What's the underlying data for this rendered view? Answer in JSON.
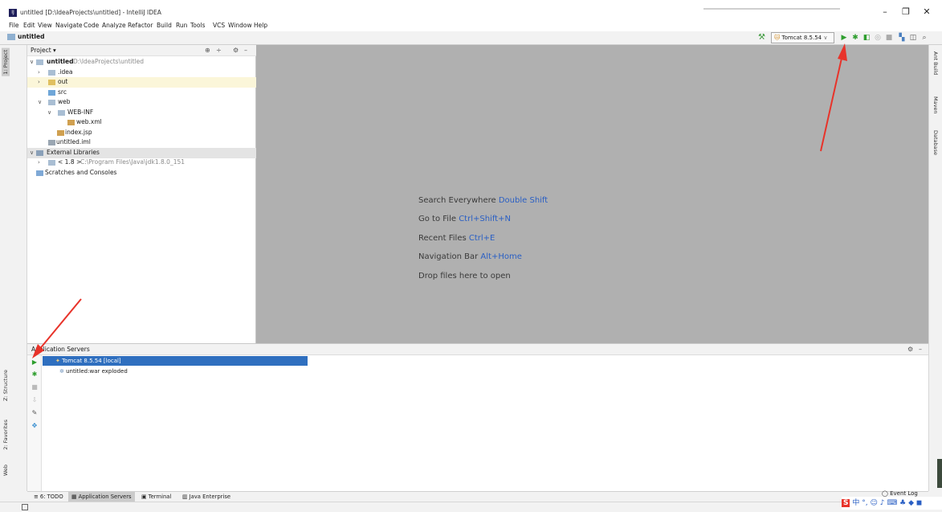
{
  "window": {
    "title": "untitled [D:\\IdeaProjects\\untitled] - IntelliJ IDEA",
    "minimize": "–",
    "restore": "❐",
    "close": "✕"
  },
  "menu": [
    "File",
    "Edit",
    "View",
    "Navigate",
    "Code",
    "Analyze",
    "Refactor",
    "Build",
    "Run",
    "Tools",
    "VCS",
    "Window",
    "Help"
  ],
  "navbar": {
    "breadcrumb": "untitled",
    "run_config": "Tomcat 8.5.54",
    "run_config_caret": "∨"
  },
  "left_stripe": {
    "project_tab": "1: Project",
    "structure_tab": "Z: Structure",
    "favorites_tab": "2: Favorites",
    "web_tab": "Web"
  },
  "right_stripe": {
    "ant_tab": "Ant Build",
    "maven_tab": "Maven",
    "database_tab": "Database"
  },
  "project_panel": {
    "header": "Project ▾",
    "tree": [
      {
        "label": "untitled",
        "extra": "D:\\IdeaProjects\\untitled"
      },
      {
        "label": ".idea"
      },
      {
        "label": "out"
      },
      {
        "label": "src"
      },
      {
        "label": "web"
      },
      {
        "label": "WEB-INF"
      },
      {
        "label": "web.xml"
      },
      {
        "label": "index.jsp"
      },
      {
        "label": "untitled.iml"
      },
      {
        "label": "External Libraries"
      },
      {
        "label": "< 1.8 >",
        "extra": "C:\\Program Files\\Java\\jdk1.8.0_151"
      },
      {
        "label": "Scratches and Consoles"
      }
    ]
  },
  "editor_hints": [
    {
      "text": "Search Everywhere",
      "shortcut": "Double Shift"
    },
    {
      "text": "Go to File",
      "shortcut": "Ctrl+Shift+N"
    },
    {
      "text": "Recent Files",
      "shortcut": "Ctrl+E"
    },
    {
      "text": "Navigation Bar",
      "shortcut": "Alt+Home"
    },
    {
      "text": "Drop files here to open",
      "shortcut": ""
    }
  ],
  "servers_panel": {
    "title": "Application Servers",
    "server": "Tomcat 8.5.54 [local]",
    "artifact": "untitled:war exploded"
  },
  "bottom_tabs": [
    {
      "label": "6: TODO",
      "icon": "≡"
    },
    {
      "label": "Application Servers",
      "icon": "▦"
    },
    {
      "label": "Terminal",
      "icon": "▣"
    },
    {
      "label": "Java Enterprise",
      "icon": "▥"
    }
  ],
  "status": {
    "event_log": "Event Log",
    "ime_text": "中"
  },
  "colors": {
    "selection": "#2f6fbf",
    "run_green": "#2e9e2e",
    "editor_bg": "#b0b0b0",
    "shortcut_blue": "#2a5fc4",
    "annotation_red": "#e8332a"
  }
}
